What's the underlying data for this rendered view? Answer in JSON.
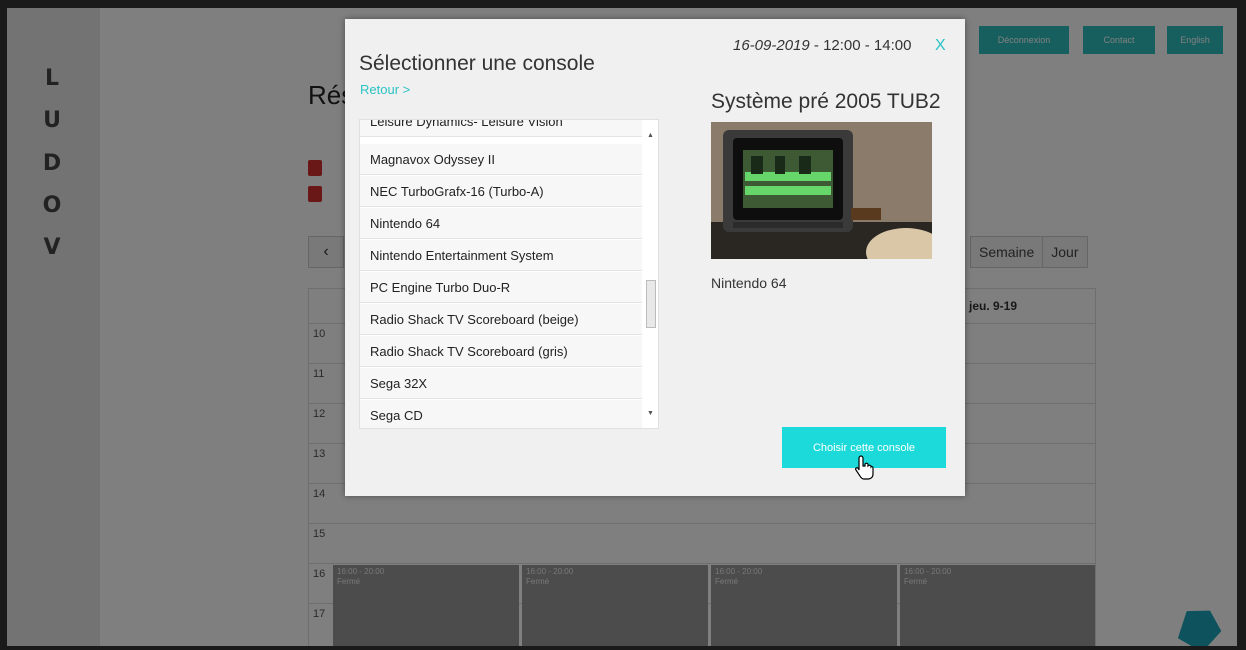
{
  "brand": {
    "letters": [
      "L",
      "U",
      "D",
      "O",
      "V"
    ]
  },
  "header": {
    "logout_label": "Déconnexion",
    "contact_label": "Contact",
    "language_label": "English"
  },
  "page": {
    "title": "Réservation",
    "prev_label": "‹",
    "view_week_label": "Semaine",
    "view_day_label": "Jour"
  },
  "calendar": {
    "day_header": "jeu. 9-19",
    "hours": [
      "10",
      "11",
      "12",
      "13",
      "14",
      "15",
      "16",
      "17"
    ],
    "closed_slot": {
      "time": "16:00 - 20:00",
      "label": "Fermé"
    }
  },
  "modal": {
    "title": "Sélectionner une console",
    "date": "16-09-2019",
    "time": " - 12:00 - 14:00",
    "close_label": "X",
    "back_label": "Retour >",
    "consoles": [
      "Leisure Dynamics- Leisure Vision",
      "Magnavox Odyssey II",
      "NEC TurboGrafx-16 (Turbo-A)",
      "Nintendo 64",
      "Nintendo Entertainment System",
      "PC Engine Turbo Duo-R",
      "Radio Shack TV Scoreboard (beige)",
      "Radio Shack TV Scoreboard (gris)",
      "Sega 32X",
      "Sega CD"
    ],
    "system_name": "Système pré 2005 TUB2",
    "selected_console": "Nintendo 64",
    "choose_label": "Choisir cette console"
  }
}
